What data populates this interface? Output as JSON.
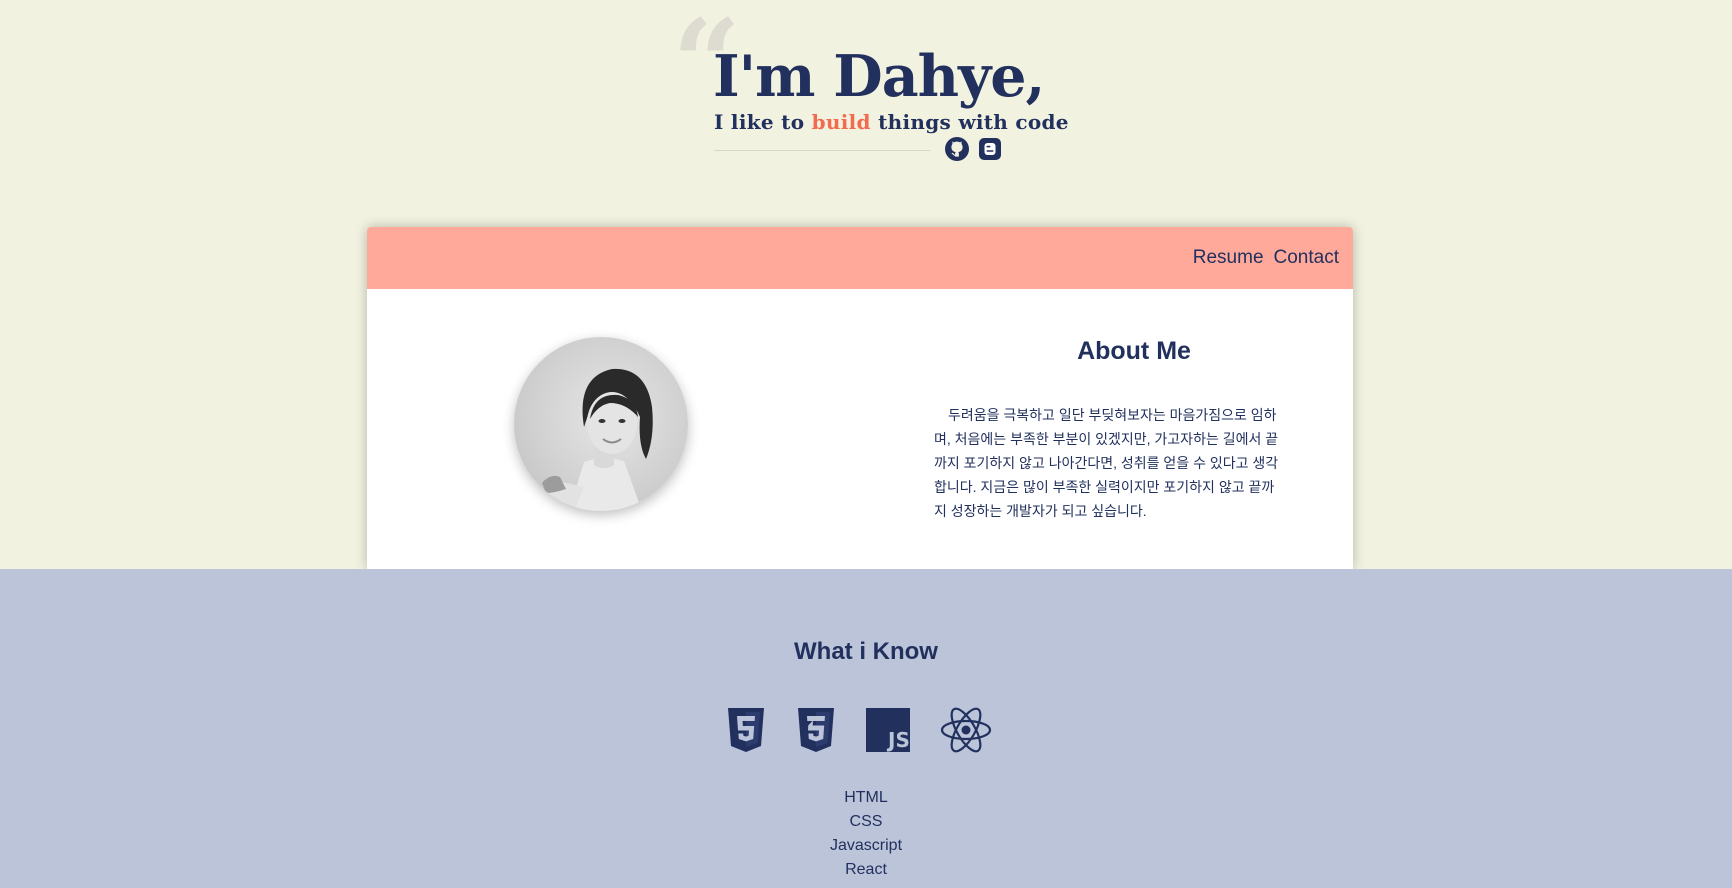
{
  "hero": {
    "quote_mark": "“",
    "title": "I'm Dahye,",
    "subtitle_pre": "I like to ",
    "subtitle_highlight": "build",
    "subtitle_post": " things with code",
    "highlight_color": "#f26b4f",
    "social": [
      {
        "icon": "github-icon"
      },
      {
        "icon": "blogger-icon"
      }
    ]
  },
  "nav": {
    "items": [
      {
        "label": "Resume"
      },
      {
        "label": "Contact"
      }
    ],
    "background": "#ffa99b"
  },
  "about": {
    "title": "About Me",
    "text": "두려움을 극복하고 일단 부딪혀보자는 마음가짐으로 임하며, 처음에는 부족한 부분이 있겠지만, 가고자하는 길에서 끝까지 포기하지 않고 나아간다면, 성취를 얻을 수 있다고 생각합니다. 지금은 많이 부족한 실력이지만 포기하지 않고 끝까지 성장하는 개발자가 되고 싶습니다."
  },
  "skills": {
    "title": "What i Know",
    "icons": [
      "html5-icon",
      "css3-icon",
      "javascript-icon",
      "react-icon"
    ],
    "list": [
      "HTML",
      "CSS",
      "Javascript",
      "React"
    ],
    "background": "#bcc4d9"
  },
  "colors": {
    "page_bg": "#f2f2e1",
    "primary_text": "#22305e"
  }
}
